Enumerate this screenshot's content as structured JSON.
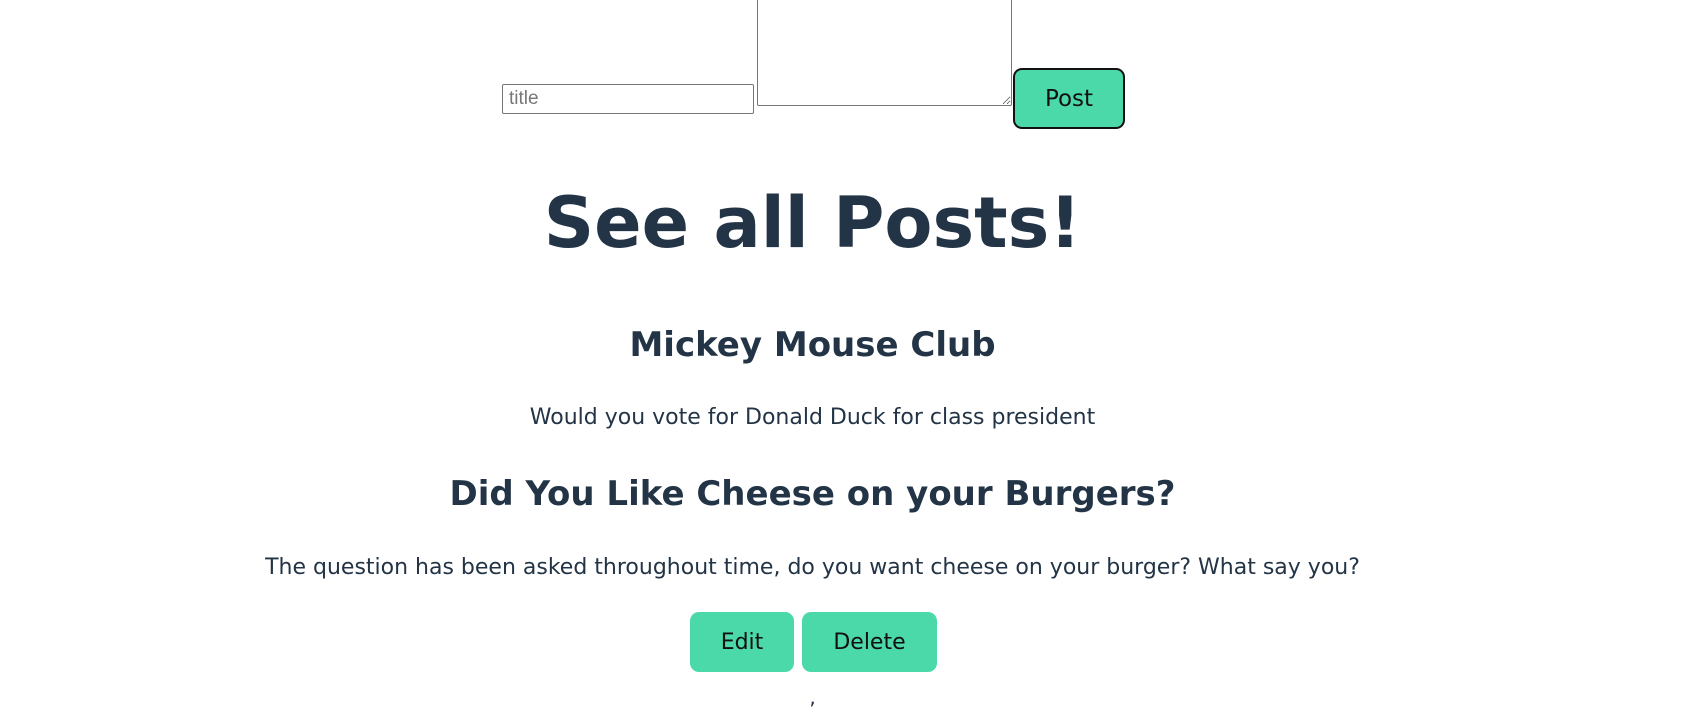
{
  "form": {
    "title_placeholder": "title",
    "title_value": "",
    "content_value": "",
    "post_label": "Post"
  },
  "heading": "See all Posts!",
  "posts": [
    {
      "title": "Mickey Mouse Club",
      "body": "Would you vote for Donald Duck for class president"
    },
    {
      "title": "Did You Like Cheese on your Burgers?",
      "body": "The question has been asked throughout time, do you want cheese on your burger? What say you?",
      "edit_label": "Edit",
      "delete_label": "Delete"
    }
  ],
  "separator": ",",
  "colors": {
    "accent": "#4bd9a9",
    "text": "#233446"
  }
}
